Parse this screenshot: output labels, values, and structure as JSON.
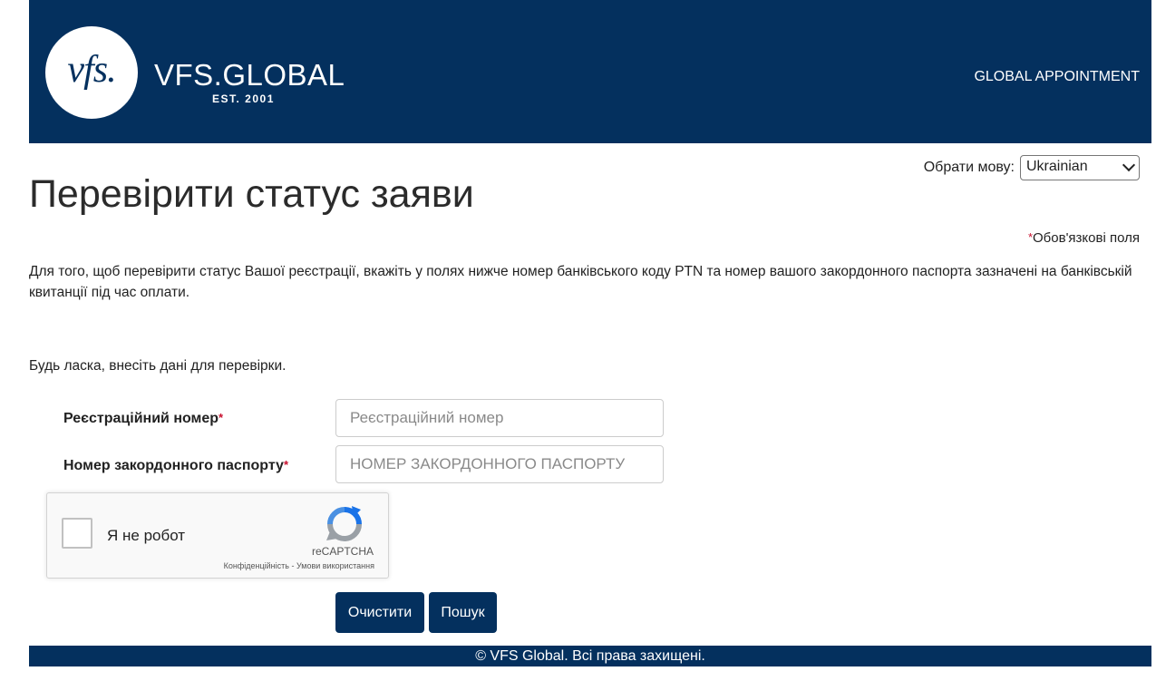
{
  "header": {
    "logo_mark": "vfs.",
    "brand_name": "VFS.GLOBAL",
    "brand_est": "EST. 2001",
    "nav_link": "GLOBAL APPOINTMENT"
  },
  "language": {
    "label": "Обрати мову:",
    "selected": "Ukrainian"
  },
  "page": {
    "title": "Перевірити статус заяви",
    "required_star": "*",
    "required_note": "Обов'язкові поля",
    "description": "Для того, щоб перевірити статус Вашої реєстрації, вкажіть у полях нижче номер банківського коду PTN та номер вашого закордонного паспорта зазначені на банківській квитанції під час оплати.",
    "prompt": "Будь ласка, внесіть дані для перевірки."
  },
  "form": {
    "registration_label": "Реєстраційний номер",
    "registration_placeholder": "Реєстраційний номер",
    "registration_value": "",
    "passport_label": "Номер закордонного паспорту",
    "passport_placeholder": "НОМЕР ЗАКОРДОННОГО ПАСПОРТУ",
    "passport_value": "",
    "required_star": "*"
  },
  "captcha": {
    "label": "Я не робот",
    "brand": "reCAPTCHA",
    "links": "Конфіденційність - Умови використання"
  },
  "buttons": {
    "clear": "Очистити",
    "search": "Пошук"
  },
  "footer": {
    "text": "© VFS Global. Всі права захищені."
  },
  "colors": {
    "brand_navy": "#04305e",
    "required_red": "#c8102e"
  }
}
